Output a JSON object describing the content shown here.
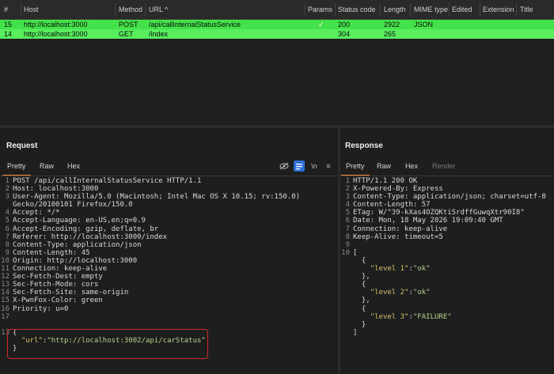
{
  "history": {
    "columns": [
      "#",
      "Host",
      "Method",
      "URL ^",
      "Params",
      "Status code",
      "Length",
      "MIME type",
      "Edited",
      "Extension",
      "Title"
    ],
    "rows": [
      {
        "id": "15",
        "host": "http://localhost:3000",
        "method": "POST",
        "url": "/api/callInternalStatusService",
        "params": "✓",
        "status": "200",
        "length": "2922",
        "mime": "JSON"
      },
      {
        "id": "14",
        "host": "http://localhost:3000",
        "method": "GET",
        "url": "/index",
        "params": "",
        "status": "304",
        "length": "265",
        "mime": ""
      }
    ]
  },
  "request": {
    "title": "Request",
    "tabs": [
      "Pretty",
      "Raw",
      "Hex"
    ],
    "lines": [
      "POST /api/callInternalStatusService HTTP/1.1",
      "Host: localhost:3000",
      "User-Agent: Mozilla/5.0 (Macintosh; Intel Mac OS X 10.15; rv:150.0)",
      "Gecko/20100101 Firefox/150.0",
      "Accept: */*",
      "Accept-Language: en-US,en;q=0.9",
      "Accept-Encoding: gzip, deflate, br",
      "Referer: http://localhost:3000/index",
      "Content-Type: application/json",
      "Content-Length: 45",
      "Origin: http://localhost:3000",
      "Connection: keep-alive",
      "Sec-Fetch-Dest: empty",
      "Sec-Fetch-Mode: cors",
      "Sec-Fetch-Site: same-origin",
      "X-PwnFox-Color: green",
      "Priority: u=0",
      "",
      "",
      "{",
      "  \"url\":\"http://localhost:3002/api/carStatus\"",
      "}"
    ],
    "line_numbers": [
      "1",
      "2",
      "3",
      "",
      "4",
      "5",
      "6",
      "7",
      "8",
      "9",
      "10",
      "11",
      "12",
      "13",
      "14",
      "15",
      "16",
      "17",
      "",
      "13",
      "",
      ""
    ]
  },
  "response": {
    "title": "Response",
    "tabs": [
      "Pretty",
      "Raw",
      "Hex",
      "Render"
    ],
    "lines": [
      "HTTP/1.1 200 OK",
      "X-Powered-By: Express",
      "Content-Type: application/json; charset=utf-8",
      "Content-Length: 57",
      "ETag: W/\"39-kXas4OZQKtiSrdffGuwqXtr90I8\"",
      "Date: Mon, 18 May 2026 19:09:40 GMT",
      "Connection: keep-alive",
      "Keep-Alive: timeout=5",
      "",
      "[",
      "  {",
      "    \"level 1\":\"ok\"",
      "  },",
      "  {",
      "    \"level 2\":\"ok\"",
      "  },",
      "  {",
      "    \"level 3\":\"FAILURE\"",
      "  }",
      "]"
    ],
    "line_numbers": [
      "1",
      "2",
      "3",
      "4",
      "5",
      "6",
      "7",
      "8",
      "9",
      "10",
      "",
      "",
      "",
      "",
      "",
      "",
      "",
      "",
      "",
      ""
    ]
  },
  "toolbar": {
    "wrap_label": "\\n",
    "menu_label": "≡"
  },
  "colors": {
    "row_highlight": "#44e24a",
    "accent": "#f58a3a",
    "red_box": "#d12a2a"
  }
}
